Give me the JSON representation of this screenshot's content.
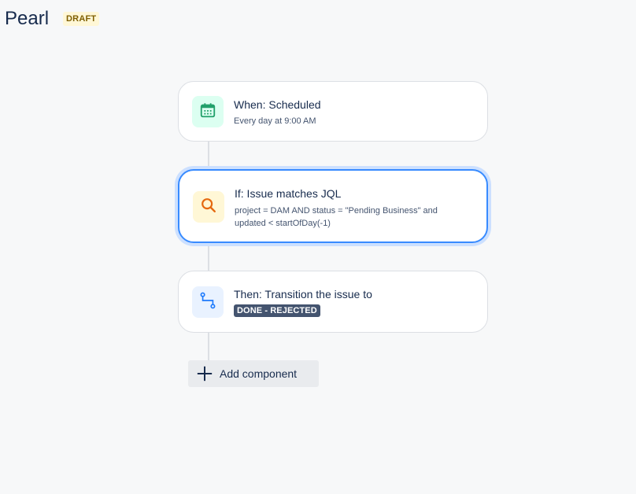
{
  "header": {
    "title": "Pearl",
    "badge": "DRAFT"
  },
  "rule": {
    "trigger": {
      "title": "When: Scheduled",
      "subtitle": "Every day at 9:00 AM",
      "icon": "calendar-icon",
      "icon_color": "#22a06b",
      "icon_bg": "#dcfff1"
    },
    "condition": {
      "title": "If: Issue matches JQL",
      "subtitle": "project = DAM AND status = \"Pending Business\" and updated < startOfDay(-1)",
      "icon": "search-icon",
      "icon_color": "#e56910",
      "icon_bg": "#fff7d6"
    },
    "action": {
      "title": "Then: Transition the issue to",
      "status": "DONE - REJECTED",
      "icon": "transition-icon",
      "icon_color": "#1d7afc",
      "icon_bg": "#e9f2ff"
    }
  },
  "add_component": {
    "label": "Add component"
  },
  "colors": {
    "selected_border": "#388bff",
    "selected_glow": "#cce0ff",
    "background": "#f7f8f9"
  }
}
